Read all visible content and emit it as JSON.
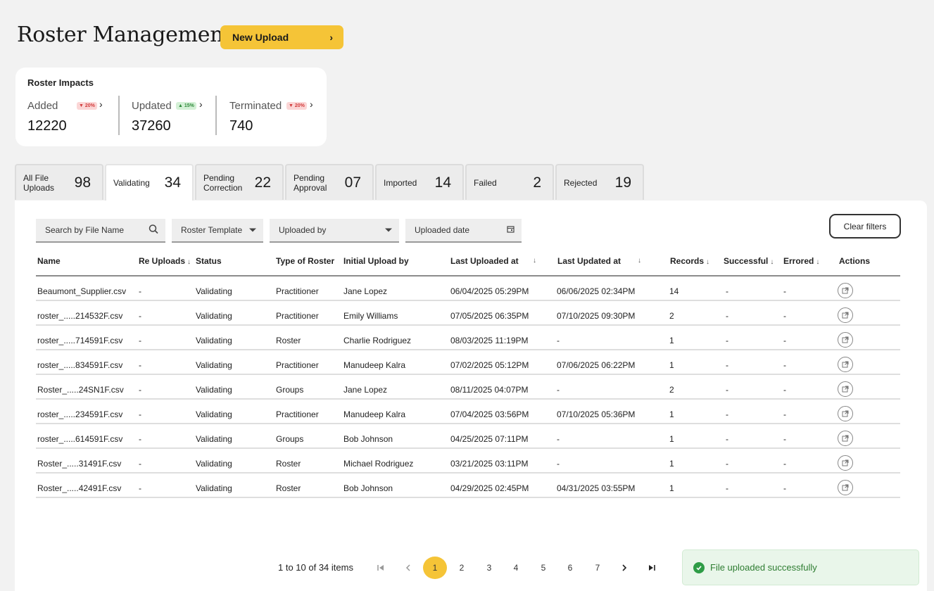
{
  "header": {
    "title": "Roster Management",
    "new_upload_label": "New Upload"
  },
  "impacts": {
    "title": "Roster Impacts",
    "metrics": [
      {
        "label": "Added",
        "value": "12220",
        "badge": "▼ 20%",
        "trend": "down"
      },
      {
        "label": "Updated",
        "value": "37260",
        "badge": "▲ 15%",
        "trend": "up"
      },
      {
        "label": "Terminated",
        "value": "740",
        "badge": "▼ 20%",
        "trend": "down"
      }
    ]
  },
  "tabs": [
    {
      "label": "All File Uploads",
      "count": "98"
    },
    {
      "label": "Validating",
      "count": "34"
    },
    {
      "label": "Pending Correction",
      "count": "22"
    },
    {
      "label": "Pending Approval",
      "count": "07"
    },
    {
      "label": "Imported",
      "count": "14"
    },
    {
      "label": "Failed",
      "count": "2"
    },
    {
      "label": "Rejected",
      "count": "19"
    }
  ],
  "active_tab": "Validating",
  "filters": {
    "search_placeholder": "Search by File Name",
    "template_label": "Roster Template",
    "uploaded_by_label": "Uploaded by",
    "uploaded_date_label": "Uploaded date",
    "clear_label": "Clear filters"
  },
  "table": {
    "headers": [
      "Name",
      "Re Uploads",
      "Status",
      "Type of Roster",
      "Initial Upload by",
      "Last Uploaded at",
      "Last Updated at",
      "Records",
      "Successful",
      "Errored",
      "Actions"
    ],
    "rows": [
      [
        "Beaumont_Supplier.csv",
        "-",
        "Validating",
        "Practitioner",
        "Jane Lopez",
        "06/04/2025 05:29PM",
        "06/06/2025 02:34PM",
        "14",
        "-",
        "-"
      ],
      [
        "roster_.....214532F.csv",
        "-",
        "Validating",
        "Practitioner",
        "Emily Williams",
        "07/05/2025 06:35PM",
        "07/10/2025 09:30PM",
        "2",
        "-",
        "-"
      ],
      [
        "roster_.....714591F.csv",
        "-",
        "Validating",
        "Roster",
        "Charlie Rodriguez",
        "08/03/2025 11:19PM",
        "-",
        "1",
        "-",
        "-"
      ],
      [
        "roster_.....834591F.csv",
        "-",
        "Validating",
        "Practitioner",
        "Manudeep Kalra",
        "07/02/2025 05:12PM",
        "07/06/2025 06:22PM",
        "1",
        "-",
        "-"
      ],
      [
        "Roster_.....24SN1F.csv",
        "-",
        "Validating",
        "Groups",
        "Jane Lopez",
        "08/11/2025 04:07PM",
        "-",
        "2",
        "-",
        "-"
      ],
      [
        "roster_.....234591F.csv",
        "-",
        "Validating",
        "Practitioner",
        "Manudeep Kalra",
        "07/04/2025 03:56PM",
        "07/10/2025 05:36PM",
        "1",
        "-",
        "-"
      ],
      [
        "roster_.....614591F.csv",
        "-",
        "Validating",
        "Groups",
        "Bob Johnson",
        "04/25/2025 07:11PM",
        "-",
        "1",
        "-",
        "-"
      ],
      [
        "Roster_.....31491F.csv",
        "-",
        "Validating",
        "Roster",
        "Michael Rodriguez",
        "03/21/2025 03:11PM",
        "-",
        "1",
        "-",
        "-"
      ],
      [
        "Roster_.....42491F.csv",
        "-",
        "Validating",
        "Roster",
        "Bob Johnson",
        "04/29/2025 02:45PM",
        "04/31/2025 03:55PM",
        "1",
        "-",
        "-"
      ]
    ]
  },
  "pagination": {
    "info": "1 to 10 of 34 items",
    "pages": [
      "1",
      "2",
      "3",
      "4",
      "5",
      "6",
      "7"
    ],
    "current": "1"
  },
  "toast": {
    "message": "File uploaded successfully"
  },
  "colors": {
    "accent": "#f5c437",
    "success": "#2e9c46",
    "danger": "#d23b3b"
  }
}
